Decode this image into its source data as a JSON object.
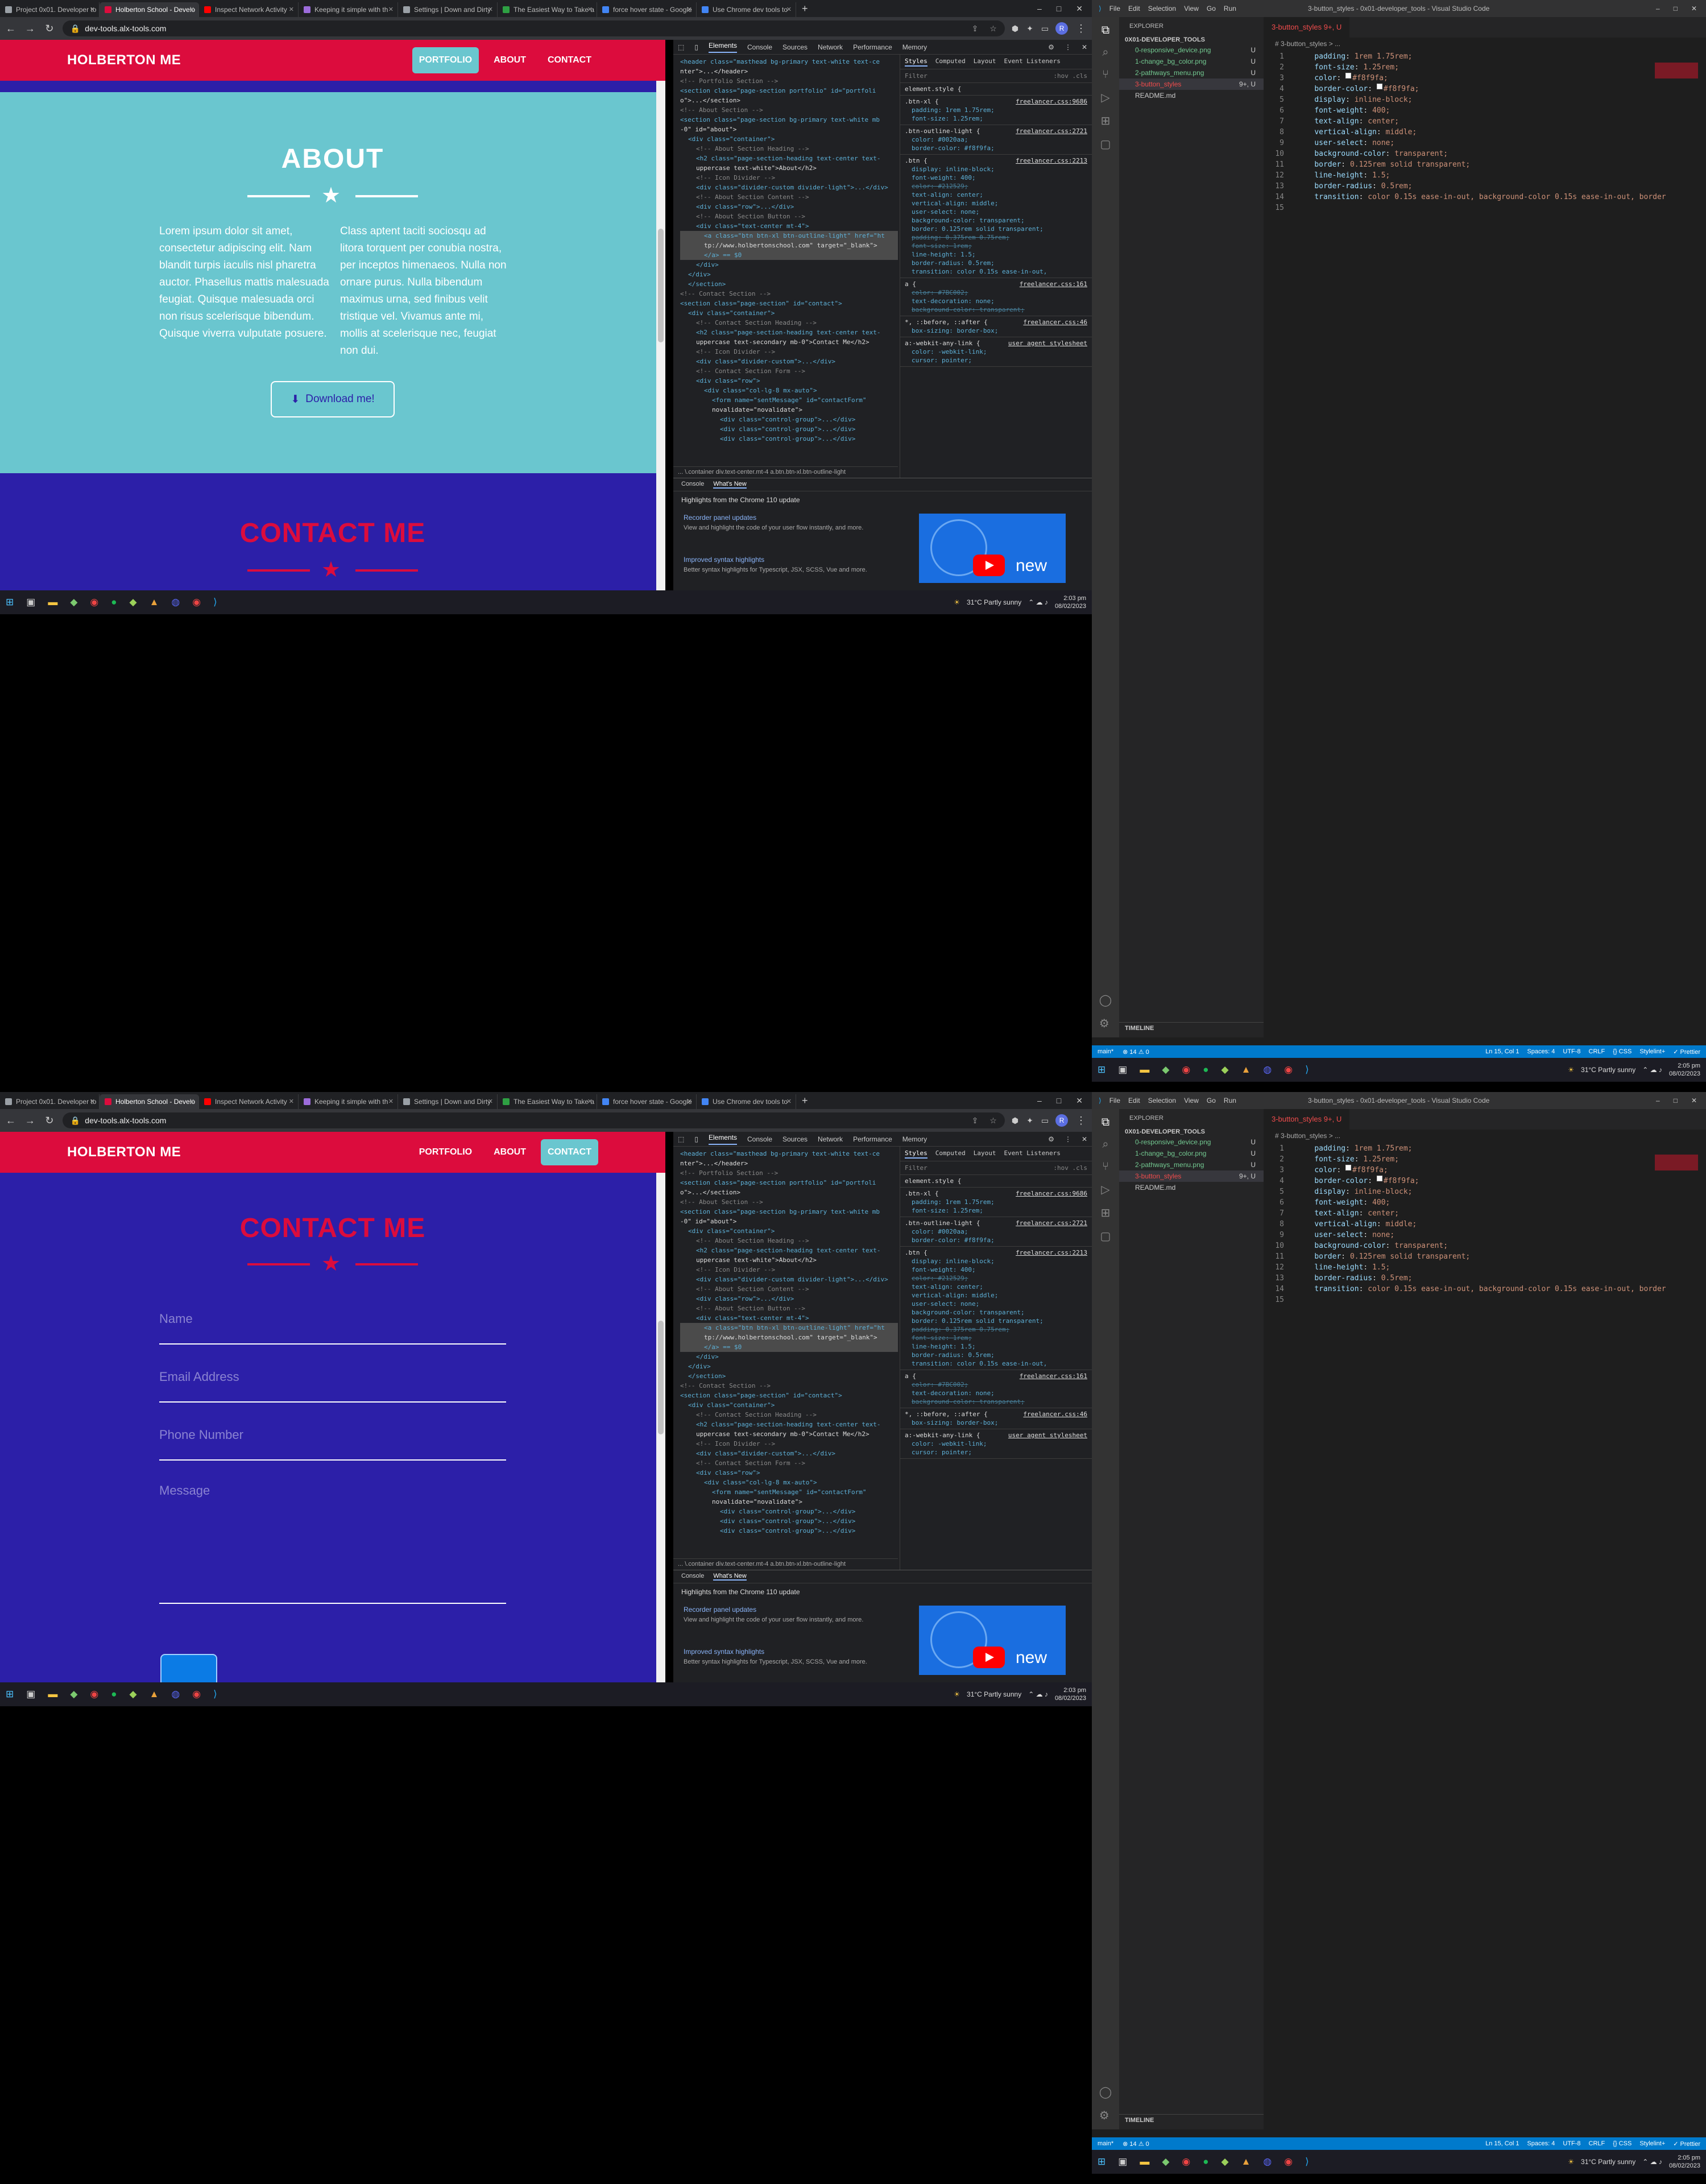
{
  "browser": {
    "tabs": [
      {
        "label": "Project 0x01. Developer to",
        "color": "#9aa0a6"
      },
      {
        "label": "Holberton School - Develo",
        "color": "#dc0c3d"
      },
      {
        "label": "Inspect Network Activity",
        "color": "#ff0000"
      },
      {
        "label": "Keeping it simple with th",
        "color": "#9c6cdb"
      },
      {
        "label": "Settings | Down and Dirty",
        "color": "#9aa0a6"
      },
      {
        "label": "The Easiest Way to Take a",
        "color": "#2ea043"
      },
      {
        "label": "force hover state - Google",
        "color": "#4285f4"
      },
      {
        "label": "Use Chrome dev tools to",
        "color": "#4285f4"
      }
    ],
    "url": "dev-tools.alx-tools.com",
    "avatar": "R"
  },
  "site": {
    "brand": "HOLBERTON ME",
    "nav": [
      "PORTFOLIO",
      "ABOUT",
      "CONTACT"
    ],
    "about_title": "ABOUT",
    "about_left": "Lorem ipsum dolor sit amet, consectetur adipiscing elit. Nam blandit turpis iaculis nisl pharetra auctor. Phasellus mattis malesuada feugiat. Quisque malesuada orci non risus scelerisque bibendum. Quisque viverra vulputate posuere.",
    "about_right": "Class aptent taciti sociosqu ad litora torquent per conubia nostra, per inceptos himenaeos. Nulla non ornare purus. Nulla bibendum maximus urna, sed finibus velit tristique vel. Vivamus ante mi, mollis at scelerisque nec, feugiat non dui.",
    "download_label": "Download me!",
    "contact_title": "CONTACT ME",
    "form": {
      "name": "Name",
      "email": "Email Address",
      "phone": "Phone Number",
      "message": "Message"
    },
    "accent_red": "#dc0c3d",
    "accent_teal": "#6ac6cf",
    "purple": "#2c1fa8"
  },
  "devtools": {
    "tabs": [
      "Elements",
      "Console",
      "Sources",
      "Network",
      "Performance",
      "Memory"
    ],
    "dom": [
      "<header class=\"masthead bg-primary text-white text-ce",
      "nter\">...</header>",
      "<!-- Portfolio Section -->",
      "<section class=\"page-section portfolio\" id=\"portfoli",
      "o\">...</section>",
      "<!-- About Section -->",
      "<section class=\"page-section bg-primary text-white mb",
      "-0\" id=\"about\">",
      "<div class=\"container\">",
      "<!-- About Section Heading -->",
      "<h2 class=\"page-section-heading text-center text-",
      "uppercase text-white\">About</h2>",
      "<!-- Icon Divider -->",
      "<div class=\"divider-custom divider-light\">...</div>",
      "<!-- About Section Content -->",
      "<div class=\"row\">...</div>",
      "<!-- About Section Button -->",
      "<div class=\"text-center mt-4\">",
      "<a class=\"btn btn-xl btn-outline-light\" href=\"ht",
      "tp://www.holbertonschool.com\" target=\"_blank\">",
      "</a> == $0",
      "</div>",
      "</div>",
      "</section>",
      "<!-- Contact Section -->",
      "<section class=\"page-section\" id=\"contact\">",
      "<div class=\"container\">",
      "<!-- Contact Section Heading -->",
      "<h2 class=\"page-section-heading text-center text-",
      "uppercase text-secondary mb-0\">Contact Me</h2>",
      "<!-- Icon Divider -->",
      "<div class=\"divider-custom\">...</div>",
      "<!-- Contact Section Form -->",
      "<div class=\"row\">",
      "<div class=\"col-lg-8 mx-auto\">",
      "<form name=\"sentMessage\" id=\"contactForm\"",
      "novalidate=\"novalidate\">",
      "<div class=\"control-group\">...</div>",
      "<div class=\"control-group\">...</div>",
      "<div class=\"control-group\">...</div>"
    ],
    "crumbs": "... \\.container   div.text-center.mt-4   a.btn.btn-xl.btn-outline-light",
    "style_tabs": [
      "Styles",
      "Computed",
      "Layout",
      "Event Listeners"
    ],
    "filter": "Filter",
    "filter_opts": ":hov .cls",
    "rules": [
      {
        "sel": "element.style {",
        "file": "",
        "props": []
      },
      {
        "sel": ".btn-xl {",
        "file": "freelancer.css:9686",
        "props": [
          "padding: 1rem 1.75rem;",
          "font-size: 1.25rem;"
        ]
      },
      {
        "sel": ".btn-outline-light {",
        "file": "freelancer.css:2721",
        "props": [
          "color: #0020aa;",
          "border-color: #f8f9fa;"
        ]
      },
      {
        "sel": ".btn {",
        "file": "freelancer.css:2213",
        "props": [
          "display: inline-block;",
          "font-weight: 400;",
          "color: #212529;",
          "text-align: center;",
          "vertical-align: middle;",
          "user-select: none;",
          "background-color: transparent;",
          "border: 0.125rem solid transparent;",
          "padding: 0.375rem 0.75rem;",
          "font-size: 1rem;",
          "line-height: 1.5;",
          "border-radius: 0.5rem;",
          "transition: color 0.15s ease-in-out,"
        ]
      },
      {
        "sel": "a {",
        "file": "freelancer.css:161",
        "props": [
          "color: #7BC002;",
          "text-decoration: none;",
          "background-color: transparent;"
        ]
      },
      {
        "sel": "*, ::before, ::after {",
        "file": "freelancer.css:46",
        "props": [
          "box-sizing: border-box;"
        ]
      },
      {
        "sel": "a:-webkit-any-link {",
        "file": "user agent stylesheet",
        "props": [
          "color: -webkit-link;",
          "cursor: pointer;"
        ]
      }
    ],
    "drawer_tabs": [
      "Console",
      "What's New"
    ],
    "highlights": "Highlights from the Chrome 110 update",
    "card1_title": "Recorder panel updates",
    "card1_text": "View and highlight the code of your user flow instantly, and more.",
    "card2_title": "Improved syntax highlights",
    "card2_text": "Better syntax highlights for Typescript, JSX, SCSS, Vue and more.",
    "video_word": "new"
  },
  "vscode": {
    "menu": [
      "File",
      "Edit",
      "Selection",
      "View",
      "Go",
      "Run"
    ],
    "title": "3-button_styles - 0x01-developer_tools - Visual Studio Code",
    "explorer": "EXPLORER",
    "project": "0X01-DEVELOPER_TOOLS",
    "files": [
      {
        "name": "0-responsive_device.png",
        "mark": "U"
      },
      {
        "name": "1-change_bg_color.png",
        "mark": "U"
      },
      {
        "name": "2-pathways_menu.png",
        "mark": "U"
      },
      {
        "name": "3-button_styles",
        "mark": "9+, U"
      },
      {
        "name": "README.md",
        "mark": ""
      }
    ],
    "tab": "3-button_styles 9+, U",
    "breadcrumb": "# 3-button_styles > ...",
    "timeline": "TIMELINE",
    "code": [
      {
        "n": "1",
        "p": "padding",
        "v": "1rem 1.75rem;"
      },
      {
        "n": "2",
        "p": "font-size",
        "v": "1.25rem;"
      },
      {
        "n": "3",
        "p": "color",
        "v": "#f8f9fa;"
      },
      {
        "n": "4",
        "p": "border-color",
        "v": "#f8f9fa;"
      },
      {
        "n": "5",
        "p": "display",
        "v": "inline-block;"
      },
      {
        "n": "6",
        "p": "font-weight",
        "v": "400;"
      },
      {
        "n": "7",
        "p": "text-align",
        "v": "center;"
      },
      {
        "n": "8",
        "p": "vertical-align",
        "v": "middle;"
      },
      {
        "n": "9",
        "p": "user-select",
        "v": "none;"
      },
      {
        "n": "10",
        "p": "background-color",
        "v": "transparent;"
      },
      {
        "n": "11",
        "p": "border",
        "v": "0.125rem solid transparent;"
      },
      {
        "n": "12",
        "p": "line-height",
        "v": "1.5;"
      },
      {
        "n": "13",
        "p": "border-radius",
        "v": "0.5rem;"
      },
      {
        "n": "14",
        "p": "transition",
        "v": "color 0.15s ease-in-out, background-color 0.15s ease-in-out, border"
      },
      {
        "n": "15",
        "p": "",
        "v": ""
      }
    ],
    "status_left": [
      "main*",
      "⊗ 14 ⚠ 0"
    ],
    "status_right": [
      "Ln 15, Col 1",
      "Spaces: 4",
      "UTF-8",
      "CRLF",
      "{} CSS",
      "Stylelint+",
      "✓ Prettier"
    ]
  },
  "taskbar": {
    "weather": "31°C  Partly sunny",
    "time1": "2:03 pm",
    "date1": "08/02/2023",
    "time2": "2:05 pm",
    "date2": "08/02/2023"
  }
}
